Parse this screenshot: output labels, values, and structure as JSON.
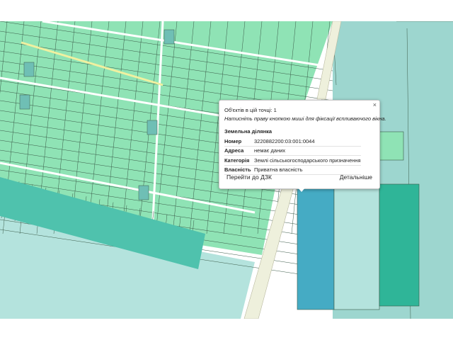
{
  "map": {
    "colors": {
      "background": "#ffffff",
      "farmland": "#8fe3b5",
      "farmland_dark": "#6fdba0",
      "parcel_outline": "#3a5a48",
      "road_white": "#ffffff",
      "road_yellow": "#f0f0a0",
      "road_beige": "#eef0dc",
      "water_teal": "#9dd6cf",
      "teal_medium": "#4fc2ad",
      "teal_dark": "#2fb598",
      "blue_selected": "#45abc4",
      "light_cyan": "#b4e3dd",
      "gray_square": "#6fbfb5"
    }
  },
  "popup": {
    "objects_count_text": "Об'єктів в цій точці: 1",
    "hint_text": "Натисніть праву кнопкою миші для фіксації вспливаючого вікна.",
    "section_title": "Земельна ділянка",
    "rows": [
      {
        "key": "Номер",
        "value": "3220882200:03:001:0044"
      },
      {
        "key": "Адреса",
        "value": "немає даних"
      },
      {
        "key": "Категорія",
        "value": "Землі сільськогосподарського призначення"
      },
      {
        "key": "Власність",
        "value": "Приватна власність"
      }
    ],
    "goto_button": "Перейти до ДЗК",
    "details_button": "Детальніше",
    "close_icon": "close-icon",
    "close_glyph": "×"
  }
}
